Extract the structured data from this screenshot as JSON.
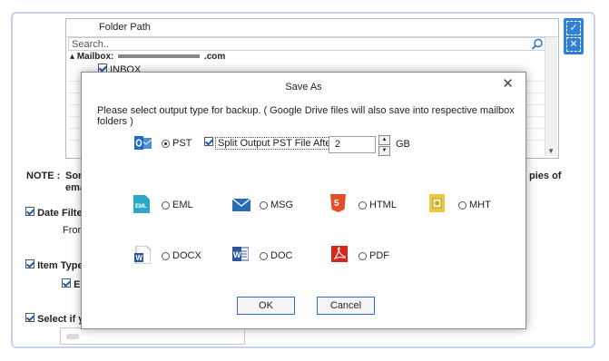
{
  "folder_tree": {
    "header": "Folder Path",
    "search_placeholder": "Search..",
    "mailbox_label": "Mailbox:",
    "mailbox_suffix": ".com",
    "inbox_label": "INBOX"
  },
  "background": {
    "note_label": "NOTE :",
    "note_text_left": "Som",
    "note_text_left2": "ema",
    "note_text_right": "pies of",
    "date_filter_label": "Date Filter",
    "from_label": "From",
    "item_type_label": "Item Type",
    "item_sub_label": "Er",
    "select_label": "Select if yo"
  },
  "dialog": {
    "title": "Save As",
    "close_glyph": "✕",
    "message": "Please select output type for backup. ( Google Drive files will also save into respective mailbox folders )",
    "selected_format": "PST",
    "split_checked": true,
    "split_label": "Split Output PST File After:",
    "split_value": "2",
    "split_unit": "GB",
    "formats": [
      {
        "label": "PST",
        "icon": "outlook-icon"
      },
      {
        "label": "EML",
        "icon": "eml-icon"
      },
      {
        "label": "MSG",
        "icon": "envelope-icon"
      },
      {
        "label": "HTML",
        "icon": "html5-icon"
      },
      {
        "label": "MHT",
        "icon": "mht-icon"
      },
      {
        "label": "DOCX",
        "icon": "docx-icon"
      },
      {
        "label": "DOC",
        "icon": "word-icon"
      },
      {
        "label": "PDF",
        "icon": "pdf-icon"
      }
    ],
    "ok_label": "OK",
    "cancel_label": "Cancel"
  },
  "colors": {
    "accent": "#2f7fd4",
    "outlook": "#1f6dc2",
    "html5": "#e34f26",
    "pdf": "#d9241b",
    "word": "#2b579a",
    "eml": "#2aa8c8",
    "mht": "#e7c84a"
  }
}
